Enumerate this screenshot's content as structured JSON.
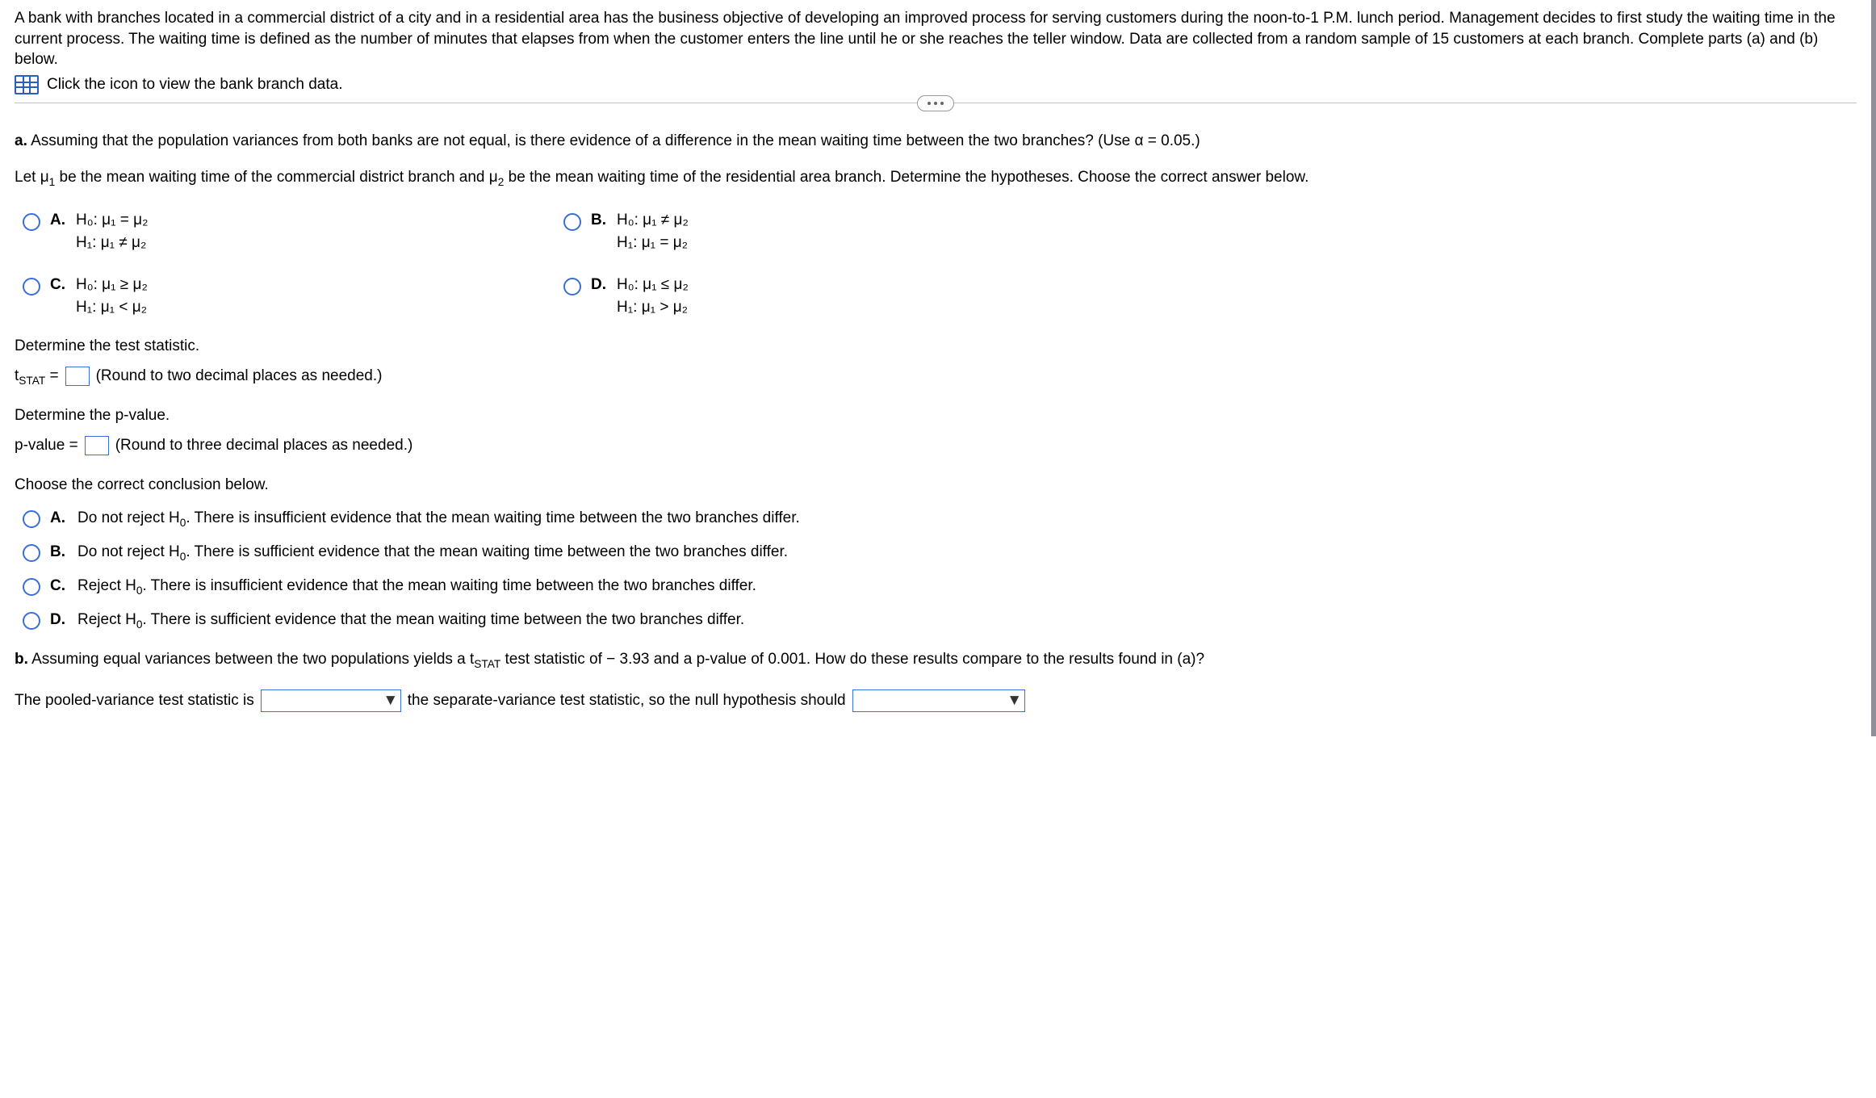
{
  "intro": "A bank with branches located in a commercial district of a city and in a residential area has the business objective of developing an improved process for serving customers during the noon-to-1 P.M. lunch period. Management decides to first study the waiting time in the current process. The waiting time is defined as the number of minutes that elapses from when the customer enters the line until he or she reaches the teller window. Data are collected from a random sample of 15 customers at each branch. Complete parts (a) and (b) below.",
  "data_link": "Click the icon to view the bank branch data.",
  "part_a": {
    "label": "a.",
    "question": "Assuming that the population variances from both banks are not equal, is there evidence of a difference in the mean waiting time between the two branches? (Use α = 0.05.)",
    "let_text_pre": "Let μ",
    "let_text_mid1": " be the mean waiting time of the commercial district branch and μ",
    "let_text_mid2": " be the mean waiting time of the residential area branch. Determine the hypotheses. Choose the correct answer below.",
    "sub1": "1",
    "sub2": "2",
    "options": {
      "A": {
        "letter": "A.",
        "h0": "H₀: μ₁ = μ₂",
        "h1": "H₁: μ₁ ≠ μ₂"
      },
      "B": {
        "letter": "B.",
        "h0": "H₀: μ₁ ≠ μ₂",
        "h1": "H₁: μ₁ = μ₂"
      },
      "C": {
        "letter": "C.",
        "h0": "H₀: μ₁ ≥ μ₂",
        "h1": "H₁: μ₁ < μ₂"
      },
      "D": {
        "letter": "D.",
        "h0": "H₀: μ₁ ≤ μ₂",
        "h1": "H₁: μ₁ > μ₂"
      }
    },
    "tstat_prompt": "Determine the test statistic.",
    "tstat_label_pre": "t",
    "tstat_label_sub": "STAT",
    "tstat_label_eq": " = ",
    "tstat_hint": "(Round to two decimal places as needed.)",
    "pval_prompt": "Determine the p-value.",
    "pval_label": "p-value = ",
    "pval_hint": "(Round to three decimal places as needed.)",
    "conclusion_prompt": "Choose the correct conclusion below.",
    "conclusions": {
      "A": {
        "letter": "A.",
        "pre": "Do not reject H",
        "sub": "0",
        "post": ". There is insufficient evidence that the mean waiting time between the two branches differ."
      },
      "B": {
        "letter": "B.",
        "pre": "Do not reject H",
        "sub": "0",
        "post": ". There is sufficient evidence that the mean waiting time between the two branches differ."
      },
      "C": {
        "letter": "C.",
        "pre": "Reject H",
        "sub": "0",
        "post": ". There is insufficient evidence that the mean waiting time between the two branches differ."
      },
      "D": {
        "letter": "D.",
        "pre": "Reject H",
        "sub": "0",
        "post": ". There is sufficient evidence that the mean waiting time between the two branches differ."
      }
    }
  },
  "part_b": {
    "label": "b.",
    "question_pre": "Assuming equal variances between the two populations yields a t",
    "question_sub": "STAT",
    "question_post": " test statistic of − 3.93 and a p-value of 0.001. How do these results compare to the results found in (a)?",
    "sentence_pre": "The pooled-variance test statistic is ",
    "sentence_mid": " the separate-variance test statistic, so the null hypothesis should ",
    "select1_value": "",
    "select2_value": ""
  }
}
